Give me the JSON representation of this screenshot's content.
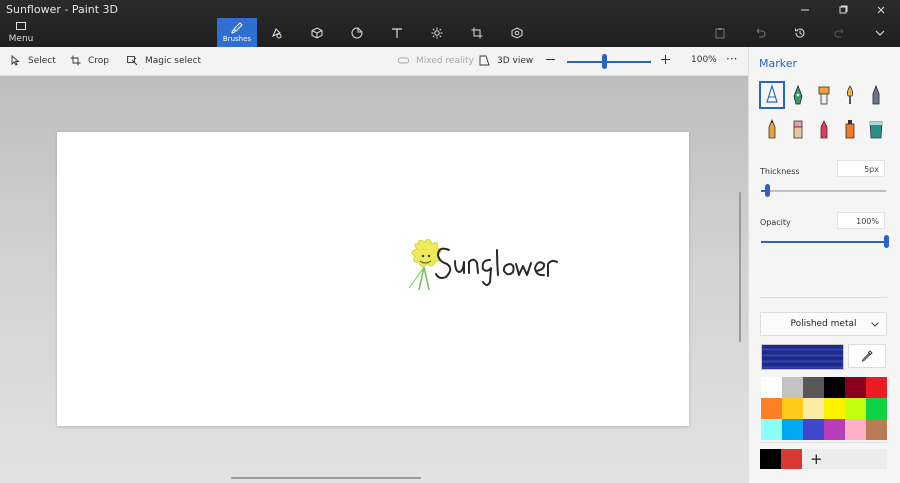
{
  "app": {
    "title": "Sunflower - Paint 3D"
  },
  "window_controls": [
    "minimize-icon",
    "maximize-icon",
    "close-icon"
  ],
  "menu": {
    "label": "Menu",
    "icon": "folder-icon"
  },
  "tools": [
    {
      "name": "brushes",
      "label": "Brushes",
      "icon": "brush-icon",
      "active": true
    },
    {
      "name": "2d-shapes",
      "label": "",
      "icon": "shapes-icon"
    },
    {
      "name": "3d-shapes",
      "label": "",
      "icon": "cube-icon"
    },
    {
      "name": "stickers",
      "label": "",
      "icon": "sticker-icon"
    },
    {
      "name": "text",
      "label": "",
      "icon": "text-icon"
    },
    {
      "name": "effects",
      "label": "",
      "icon": "sun-icon"
    },
    {
      "name": "canvas",
      "label": "",
      "icon": "canvas-icon"
    },
    {
      "name": "3d-library",
      "label": "",
      "icon": "library-icon"
    }
  ],
  "toolbar": {
    "select": "Select",
    "crop": "Crop",
    "magic_select": "Magic select",
    "mixed_reality": "Mixed reality",
    "view_3d": "3D view",
    "zoom_level": "100%",
    "zoom_fraction": 0.45
  },
  "panel": {
    "title": "Marker",
    "thickness_label": "Thickness",
    "thickness_value": "5px",
    "thickness_fraction": 0.05,
    "opacity_label": "Opacity",
    "opacity_value": "100%",
    "opacity_fraction": 1.0,
    "texture": "Polished metal",
    "selected_color": "#1d2a87",
    "palette": [
      "#ffffff",
      "#c3c3c3",
      "#585858",
      "#000000",
      "#88001b",
      "#ec1c24",
      "#ff7f27",
      "#ffca18",
      "#fdeca6",
      "#fff200",
      "#c4ff0e",
      "#0ed145",
      "#8cfffb",
      "#00a8f3",
      "#3f48cc",
      "#b83dba",
      "#ffaec8",
      "#b97a56"
    ],
    "recent_colors": [
      "#000000",
      "#d73a34"
    ],
    "add_color": "+"
  },
  "canvas": {
    "drawing_text": "Sunglower"
  }
}
